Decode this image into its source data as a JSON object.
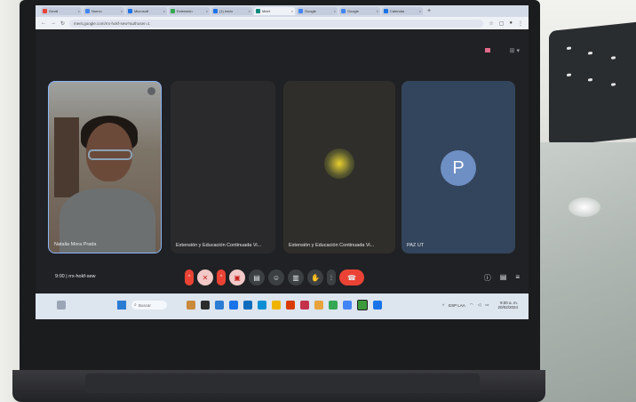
{
  "browser": {
    "tabs": [
      {
        "title": "Gmail",
        "color": "#ea4335",
        "active": false
      },
      {
        "title": "Nuevo",
        "color": "#4285f4",
        "active": false
      },
      {
        "title": "Microsoft",
        "color": "#1a73e8",
        "active": false
      },
      {
        "title": "Extensión",
        "color": "#34a853",
        "active": false
      },
      {
        "title": "(1) Inicio",
        "color": "#1a73e8",
        "active": false
      },
      {
        "title": "Meet",
        "color": "#00897b",
        "active": true
      },
      {
        "title": "Google",
        "color": "#4285f4",
        "active": false
      },
      {
        "title": "Google",
        "color": "#4285f4",
        "active": false
      },
      {
        "title": "Calendar",
        "color": "#1a73e8",
        "active": false
      }
    ],
    "url": "meet.google.com/rrx-hokf-sew?authuser=1"
  },
  "tiles": [
    {
      "name": "Natalia Mora Prada"
    },
    {
      "name": "Extensión y Educación Continuada Vi..."
    },
    {
      "name": "Extensión y Educación Continuada Vi..."
    },
    {
      "name": "PAZ UT",
      "avatar_letter": "P"
    }
  ],
  "controls": {
    "time": "9:00",
    "separator": "|",
    "meeting_code": "rrx-hokf-sew"
  },
  "taskbar": {
    "search_placeholder": "Buscar",
    "language": "ESP\nLAA",
    "clock_time": "9:00 a. m.",
    "clock_date": "20/02/2024"
  },
  "colors": {
    "meet_bg": "#202124",
    "end_call": "#ea4335",
    "avatar_blue": "#6e8fc4",
    "speaking_border": "#8ab4f8"
  }
}
